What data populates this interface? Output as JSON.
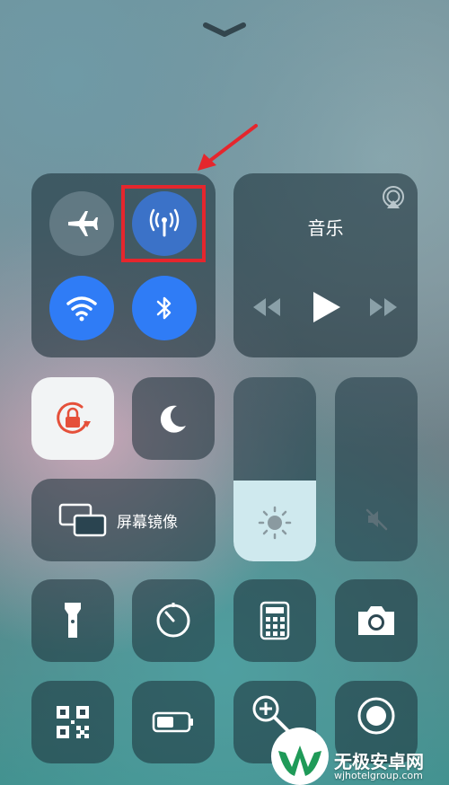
{
  "media": {
    "title": "音乐"
  },
  "screen_mirroring": {
    "label": "屏幕镜像"
  },
  "brightness": {
    "level": 0.44
  },
  "volume": {
    "level": 0.0
  },
  "annotation": {
    "color": "#e5262d"
  },
  "watermark": {
    "name": "无极安卓网",
    "url": "wjhotelgroup.com"
  },
  "colors": {
    "toggle_on": "#2f7cf6",
    "lock_icon": "#e5503a"
  }
}
